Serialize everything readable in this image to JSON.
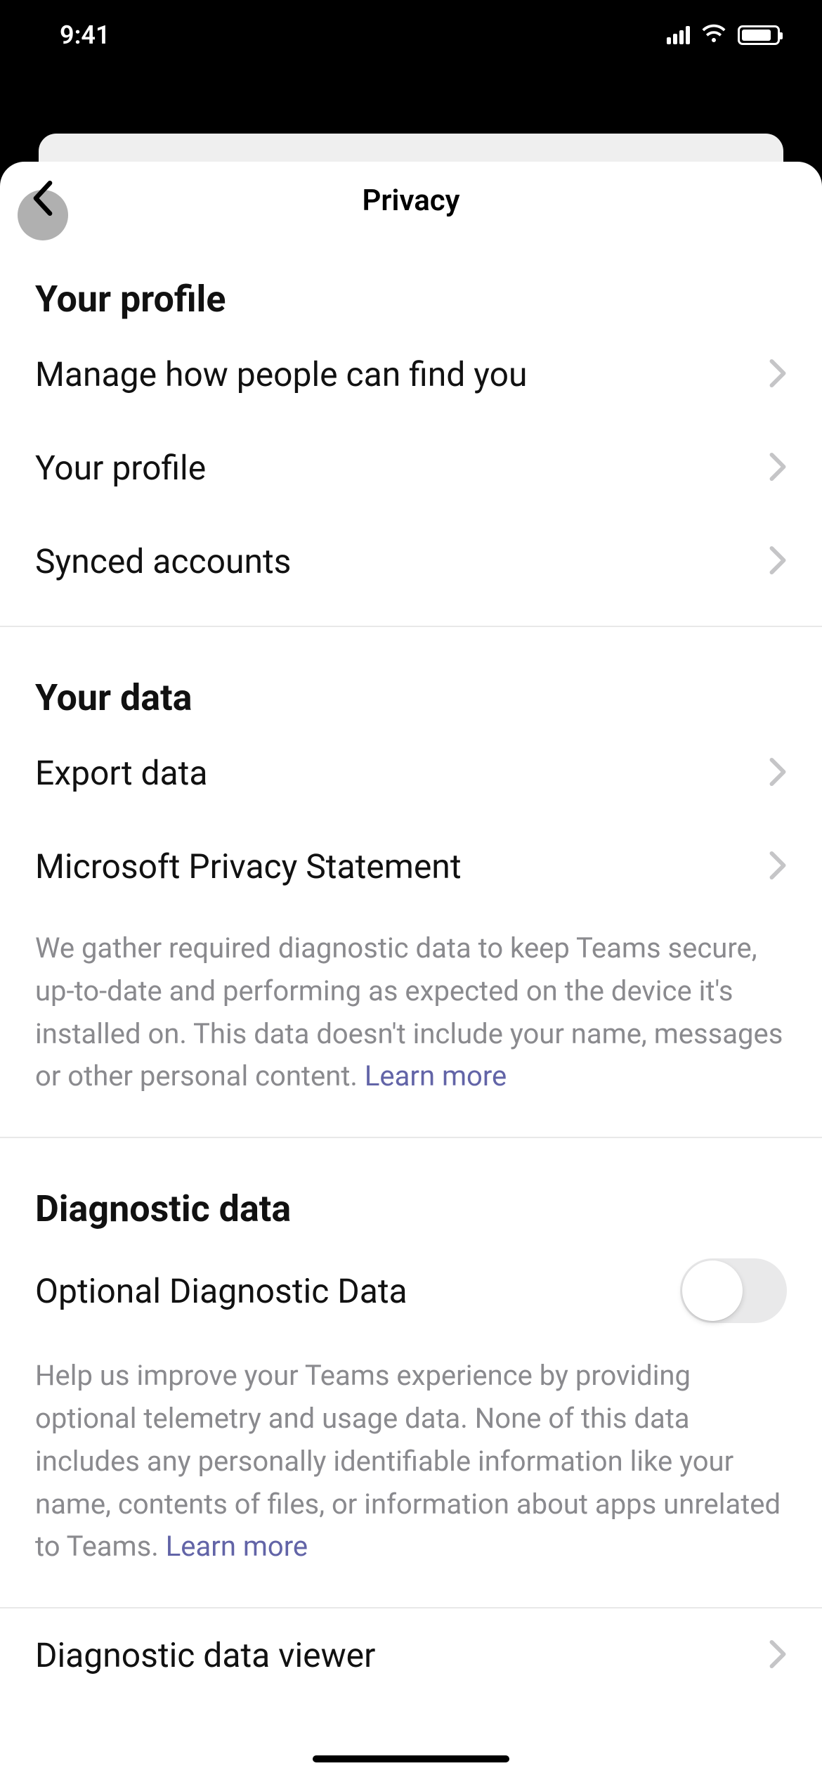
{
  "status": {
    "time": "9:41"
  },
  "page": {
    "title": "Privacy"
  },
  "sections": {
    "profile": {
      "header": "Your profile",
      "manage_find": "Manage how people can find you",
      "your_profile": "Your profile",
      "synced_accounts": "Synced accounts"
    },
    "data": {
      "header": "Your data",
      "export_data": "Export data",
      "privacy_statement": "Microsoft Privacy Statement",
      "description": "We gather required diagnostic data to keep Teams secure, up-to-date and performing as expected on the device it's installed on. This data doesn't include your name, messages or other personal content. ",
      "learn_more": "Learn more"
    },
    "diagnostic": {
      "header": "Diagnostic data",
      "optional_label": "Optional Diagnostic Data",
      "optional_on": false,
      "description": "Help us improve your Teams experience by providing optional telemetry and usage data. None of this data includes any personally identifiable information like your name, contents of files, or information about apps unrelated to Teams. ",
      "learn_more": "Learn more",
      "viewer": "Diagnostic data viewer"
    }
  }
}
